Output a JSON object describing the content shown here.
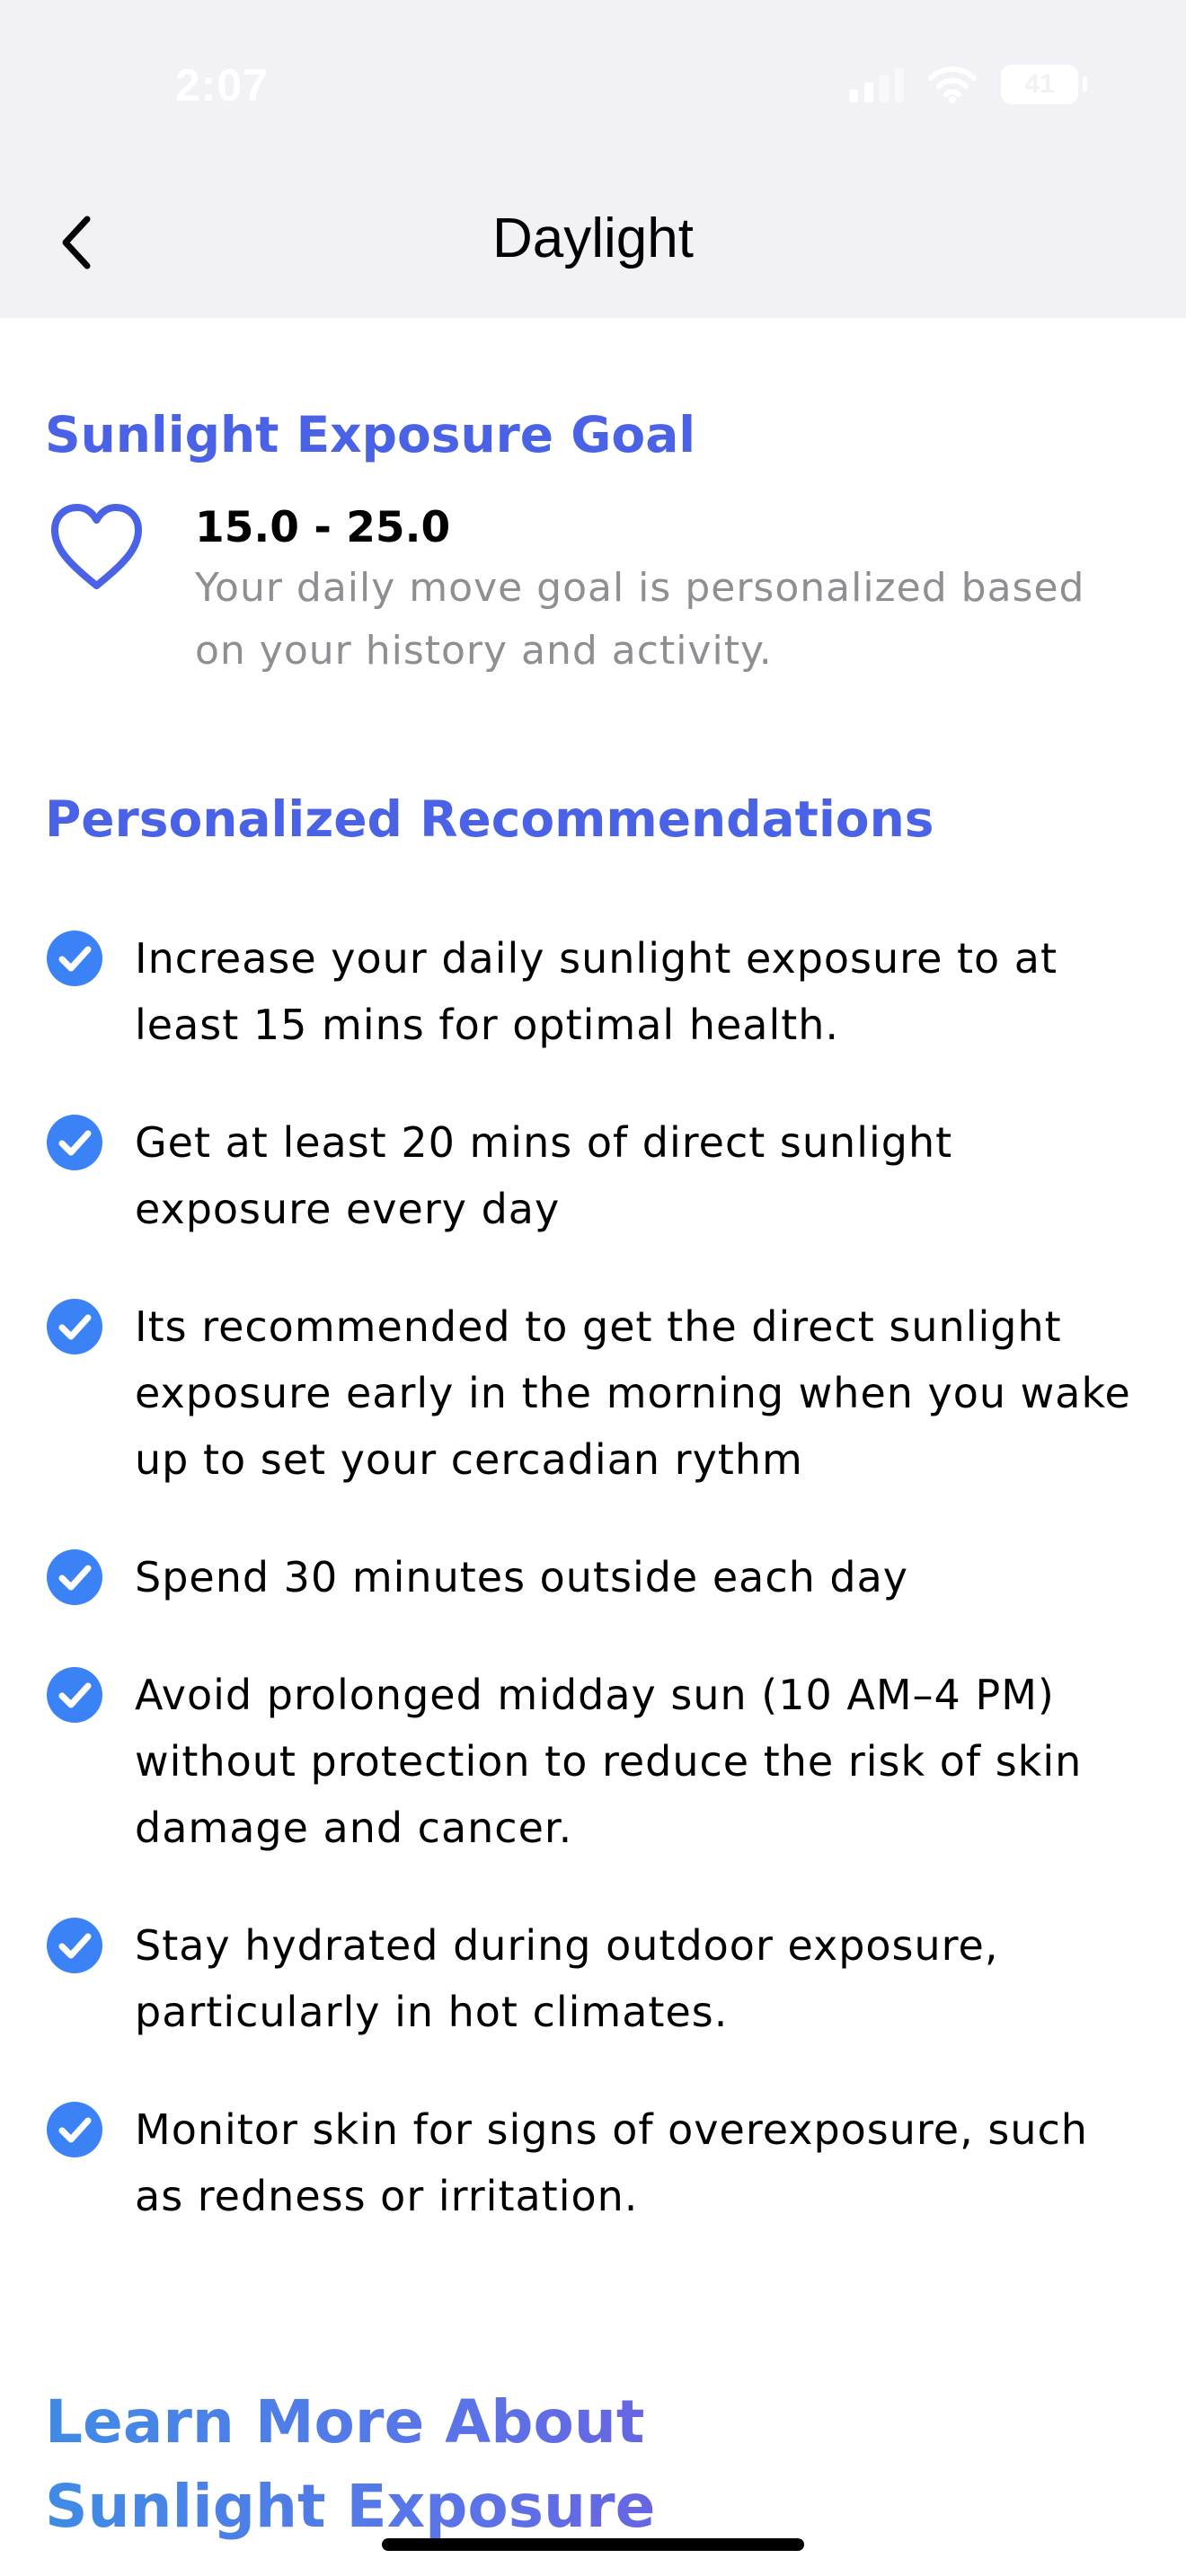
{
  "status_bar": {
    "time": "2:07",
    "battery": "41"
  },
  "nav": {
    "title": "Daylight"
  },
  "goal": {
    "heading": "Sunlight Exposure Goal",
    "value": "15.0 - 25.0",
    "description": "Your daily move goal is personalized based on your history and activity."
  },
  "recommendations": {
    "heading": "Personalized Recommendations",
    "items": [
      "Increase your daily sunlight exposure to at least 15 mins for optimal health.",
      "Get at least 20 mins of direct sunlight exposure every day",
      "Its recommended to get the direct sunlight exposure early in the morning when you wake up to set your cercadian rythm",
      "Spend 30 minutes outside each day",
      "Avoid prolonged midday sun (10 AM–4 PM) without protection to reduce the risk of skin damage and cancer.",
      "Stay hydrated during outdoor exposure, particularly in hot climates.",
      "Monitor skin for signs of overexposure, such as redness or irritation."
    ]
  },
  "learn_more": {
    "heading": "Learn More About Sunlight Exposure"
  },
  "colors": {
    "accent": "#4a62e6",
    "check": "#3b82f6",
    "header_bg": "#f1f1f6",
    "secondary_text": "#8e8e93"
  },
  "icons": {
    "back": "chevron-left-icon",
    "goal": "heart-icon",
    "recommendation": "checkmark-circle-icon"
  }
}
